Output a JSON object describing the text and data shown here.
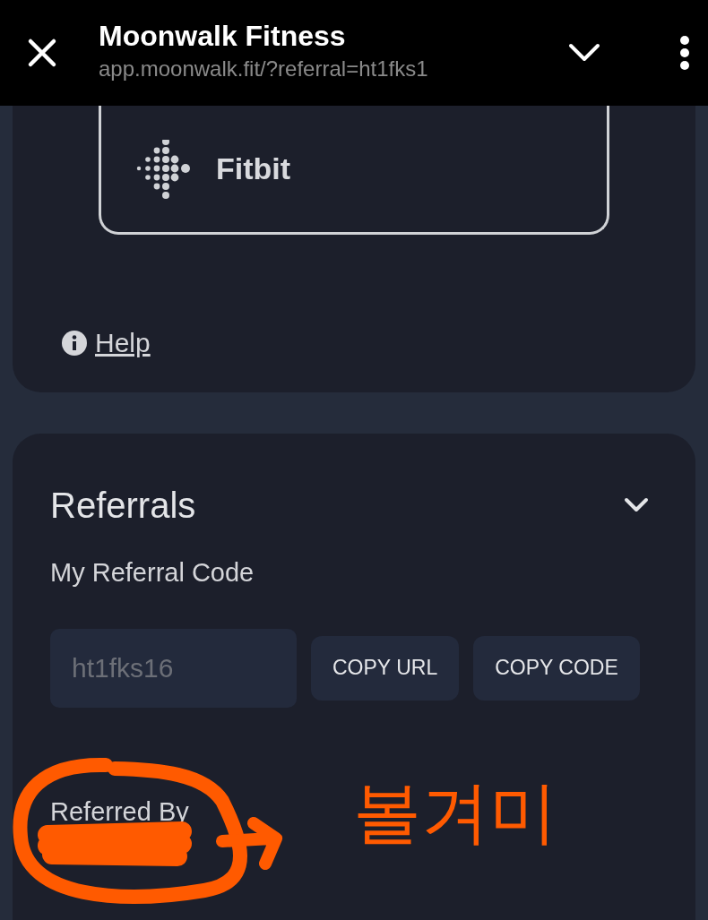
{
  "browser_bar": {
    "title": "Moonwalk Fitness",
    "url": "app.moonwalk.fit/?referral=ht1fks1"
  },
  "devices_card": {
    "device_button": "Fitbit",
    "help_link": "Help"
  },
  "referrals_card": {
    "title": "Referrals",
    "expanded": true,
    "my_code_label": "My Referral Code",
    "code_value": "ht1fks16",
    "buttons": [
      "COPY URL",
      "COPY CODE"
    ],
    "referred_by_label": "Referred By"
  },
  "annotation": {
    "text": "볼겨미"
  }
}
